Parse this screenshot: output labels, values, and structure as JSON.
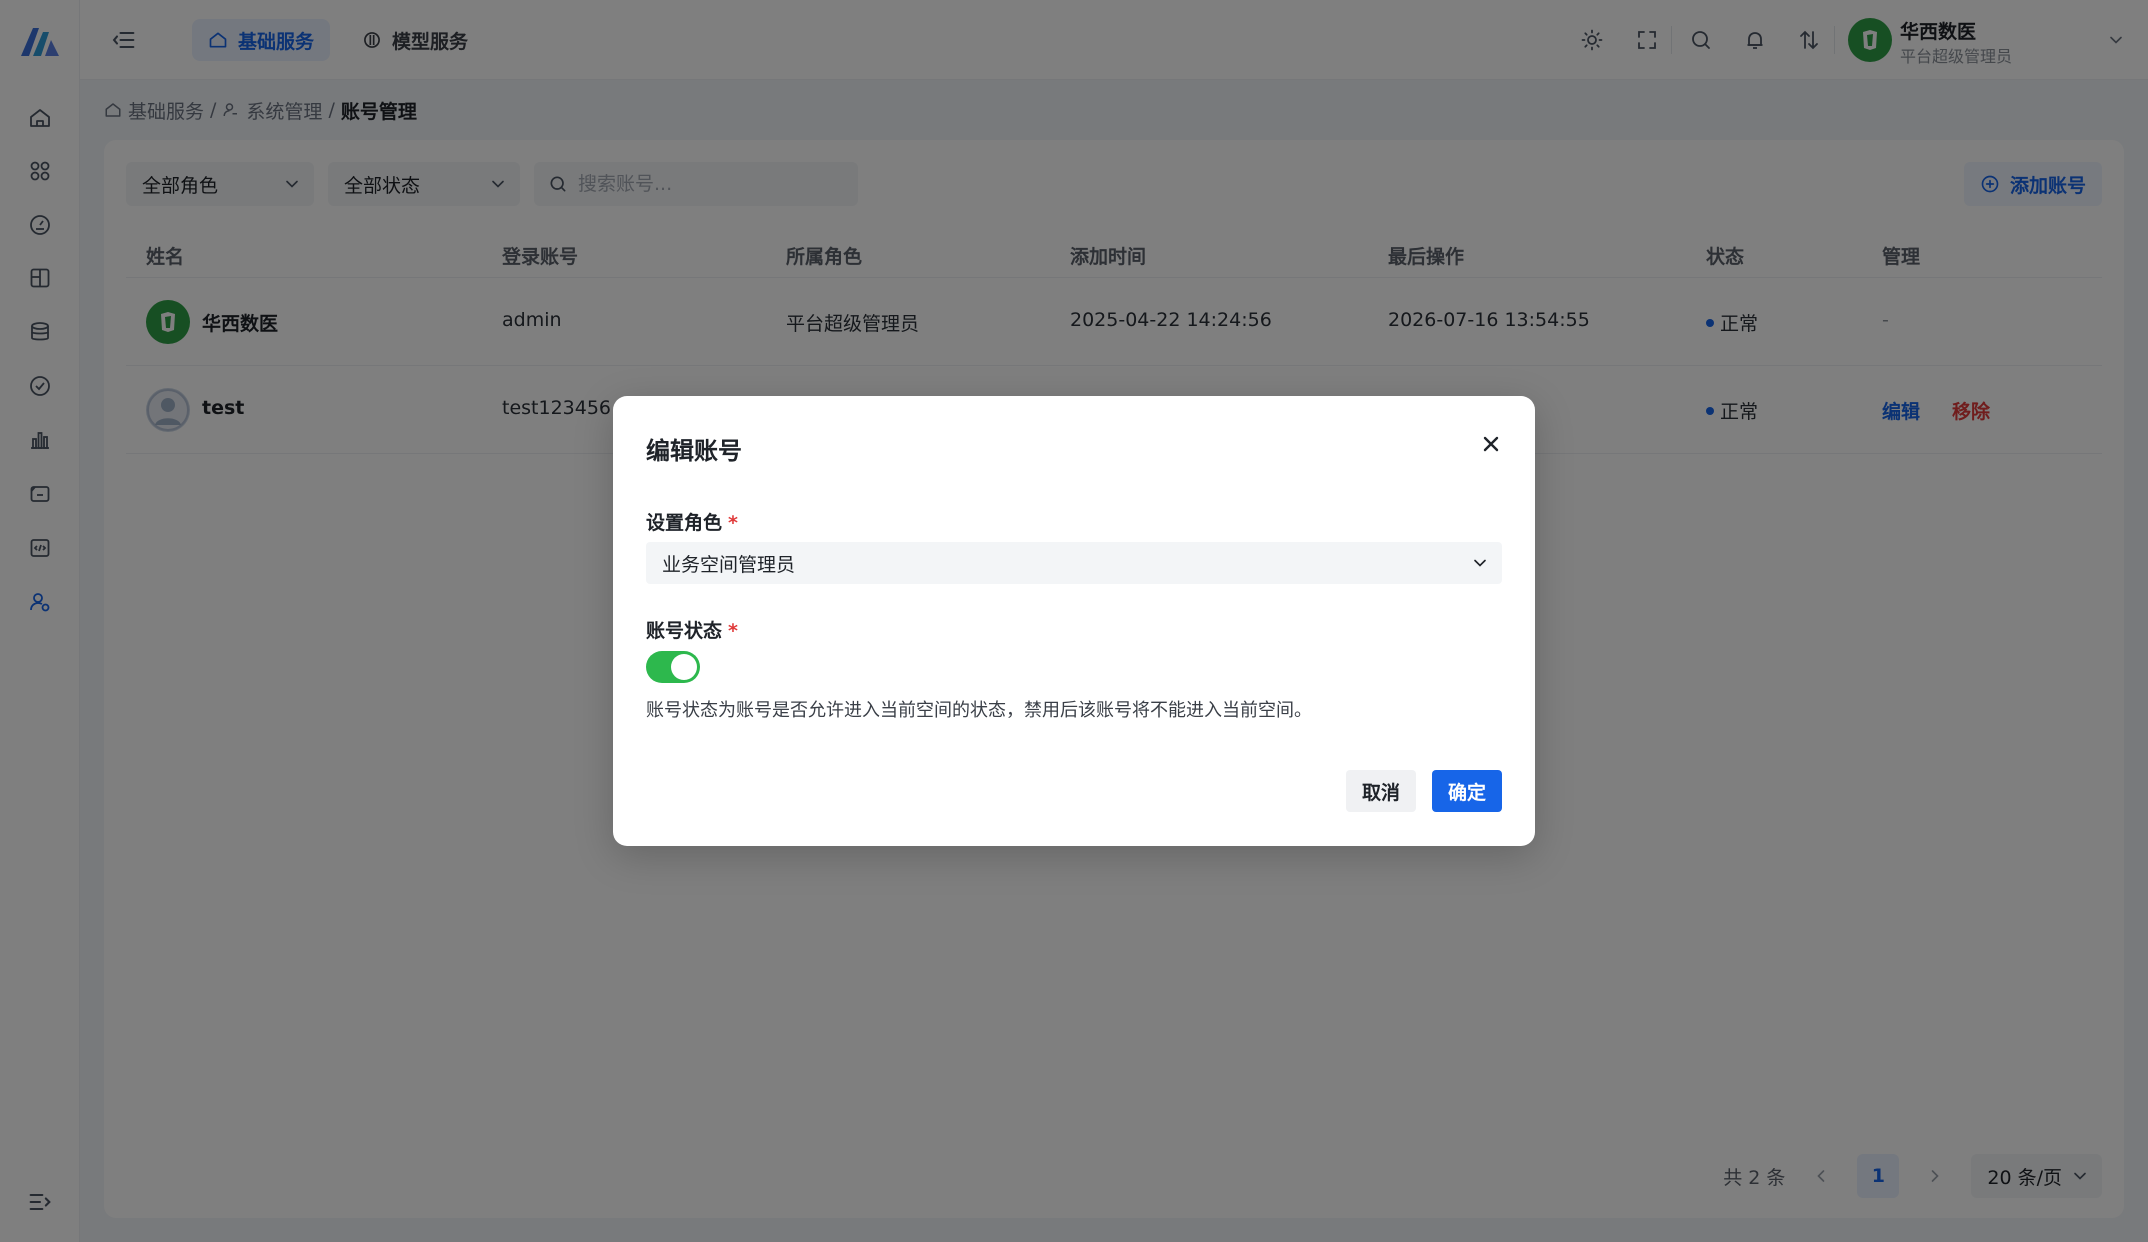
{
  "brand": {
    "logo_icon": "app-logo-icon",
    "accent": "#1765e8"
  },
  "topbar": {
    "tabs": [
      {
        "label": "基础服务",
        "icon": "home-icon",
        "active": true
      },
      {
        "label": "模型服务",
        "icon": "model-icon",
        "active": false
      }
    ],
    "tools": [
      "sun-icon",
      "fullscreen-icon",
      "search-icon",
      "bell-icon",
      "switch-icon",
      "robot-icon"
    ],
    "user": {
      "name": "华西数医",
      "role": "平台超级管理员"
    }
  },
  "sidebar": {
    "items": [
      "home-icon",
      "apps-icon",
      "dashboard-icon",
      "layout-icon",
      "database-icon",
      "check-circle-icon",
      "bar-chart-icon",
      "monitor-icon",
      "code-icon",
      "user-settings-icon"
    ],
    "active_index": 9
  },
  "breadcrumb": {
    "items": [
      "基础服务",
      "系统管理",
      "账号管理"
    ],
    "separator": "/"
  },
  "filters": {
    "role": "全部角色",
    "status": "全部状态",
    "search_placeholder": "搜索账号..."
  },
  "add_button": "添加账号",
  "table": {
    "columns": [
      "姓名",
      "登录账号",
      "所属角色",
      "添加时间",
      "最后操作",
      "状态",
      "管理"
    ],
    "rows": [
      {
        "name": "华西数医",
        "account": "admin",
        "role": "平台超级管理员",
        "added": "2025-04-22 14:24:56",
        "last_op": "2026-07-16 13:54:55",
        "status": "正常",
        "manage": "-"
      },
      {
        "name": "test",
        "account": "test123456",
        "status": "正常",
        "edit": "编辑",
        "remove": "移除"
      }
    ]
  },
  "pagination": {
    "total": "共 2 条",
    "current": "1",
    "page_size": "20 条/页"
  },
  "modal": {
    "title": "编辑账号",
    "role_label": "设置角色",
    "role_value": "业务空间管理员",
    "status_label": "账号状态",
    "required_mark": "*",
    "status_enabled": true,
    "status_help": "账号状态为账号是否允许进入当前空间的状态，禁用后该账号将不能进入当前空间。",
    "cancel": "取消",
    "confirm": "确定"
  },
  "colors": {
    "toggle_on": "#2db84d",
    "danger": "#e03a3a",
    "primary": "#1765e8"
  }
}
